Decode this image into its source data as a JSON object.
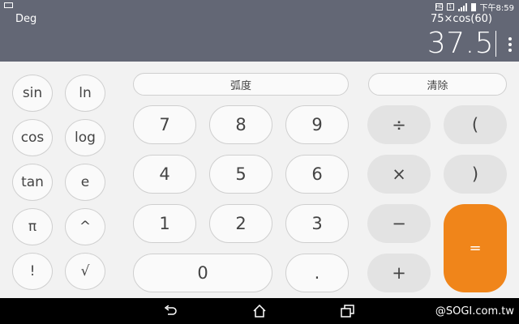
{
  "status_bar": {
    "time": "下午8:59"
  },
  "display": {
    "angle_mode": "Deg",
    "expression": "75×cos(60)",
    "result": "37.5"
  },
  "scientific_keys": [
    "sin",
    "ln",
    "cos",
    "log",
    "tan",
    "e",
    "π",
    "^",
    "!",
    "√"
  ],
  "toggle_label": "弧度",
  "clear_label": "清除",
  "number_keys": [
    "7",
    "8",
    "9",
    "4",
    "5",
    "6",
    "1",
    "2",
    "3",
    "0",
    "."
  ],
  "operator_keys": {
    "divide": "÷",
    "multiply": "×",
    "minus": "−",
    "plus": "+",
    "open_paren": "(",
    "close_paren": ")",
    "equals": "="
  },
  "watermark": "@SOGI.com.tw",
  "colors": {
    "display_bg": "#636775",
    "equals_bg": "#f0851a",
    "page_bg": "#f2f2f2"
  }
}
